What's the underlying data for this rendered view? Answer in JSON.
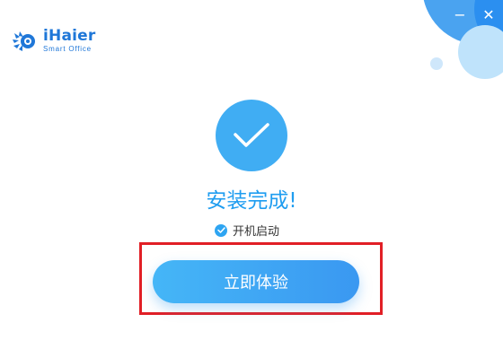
{
  "window": {
    "minimize_icon": "minimize-icon",
    "close_icon": "close-icon",
    "minimize_glyph": "−",
    "close_glyph": "✕"
  },
  "brand": {
    "name": "iHaier",
    "tagline": "Smart  Office",
    "logo_icon": "ihaier-logo-icon",
    "color": "#1f77d8"
  },
  "install": {
    "status_icon": "check-circle-icon",
    "title": "安装完成!",
    "autostart_label": "开机启动",
    "autostart_checked": true,
    "primary_button_label": "立即体验"
  },
  "colors": {
    "accent": "#40adf3",
    "title": "#1f9df0",
    "highlight": "#e11f26"
  }
}
